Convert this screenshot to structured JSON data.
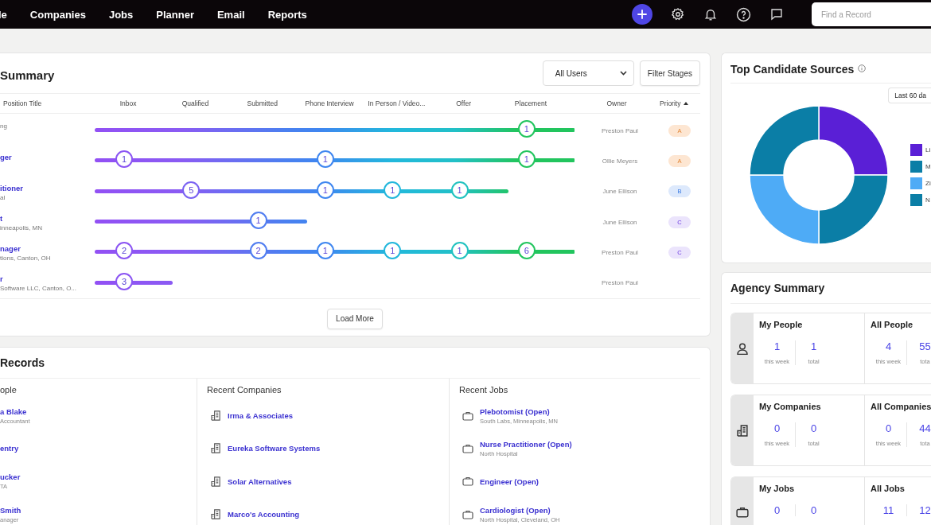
{
  "nav": {
    "items": [
      "le",
      "Companies",
      "Jobs",
      "Planner",
      "Email",
      "Reports"
    ]
  },
  "search": {
    "placeholder": "Find a Record"
  },
  "pipeline": {
    "title": "Summary",
    "user_filter": "All Users",
    "filter_button": "Filter Stages",
    "columns": {
      "title": "Position Title",
      "stages": [
        "Inbox",
        "Qualified",
        "Submitted",
        "Phone Interview",
        "In Person / Video...",
        "Offer",
        "Placement"
      ],
      "owner": "Owner",
      "priority": "Priority"
    },
    "rows": [
      {
        "subtitle": "ng",
        "stages": [
          {
            "reached": false
          },
          {
            "reached": false
          },
          {
            "reached": false
          },
          {
            "reached": false
          },
          {
            "reached": false
          },
          {
            "reached": false
          },
          {
            "reached": true,
            "count": "1"
          }
        ],
        "owner": "Preston Paul",
        "priority": {
          "label": "A",
          "color": "#fde6d2"
        }
      },
      {
        "title": "ger",
        "stages": [
          {
            "reached": true,
            "count": "1"
          },
          {
            "reached": false
          },
          {
            "reached": false
          },
          {
            "reached": true,
            "count": "1"
          },
          {
            "reached": false
          },
          {
            "reached": false
          },
          {
            "reached": true,
            "count": "1"
          }
        ],
        "owner": "Ollie Meyers",
        "priority": {
          "label": "A",
          "color": "#fde6d2"
        }
      },
      {
        "title": "itioner",
        "subtitle": "al",
        "stages": [
          {
            "reached": false
          },
          {
            "reached": true,
            "count": "5"
          },
          {
            "reached": false
          },
          {
            "reached": true,
            "count": "1"
          },
          {
            "reached": true,
            "count": "1"
          },
          {
            "reached": true,
            "count": "1"
          },
          {
            "reached": false
          }
        ],
        "owner": "June Ellison",
        "priority": {
          "label": "B",
          "color": "#dde9fc"
        }
      },
      {
        "title": "t",
        "subtitle": "inneapolis, MN",
        "stages": [
          {
            "reached": false
          },
          {
            "reached": false
          },
          {
            "reached": true,
            "count": "1"
          },
          {
            "reached": false
          },
          {
            "reached": false
          },
          {
            "reached": false
          },
          {
            "reached": false
          }
        ],
        "owner": "June Ellison",
        "priority": {
          "label": "C",
          "color": "#ebe4fc"
        }
      },
      {
        "title": "nager",
        "subtitle": "tions, Canton, OH",
        "stages": [
          {
            "reached": true,
            "count": "2"
          },
          {
            "reached": false
          },
          {
            "reached": true,
            "count": "2"
          },
          {
            "reached": true,
            "count": "1"
          },
          {
            "reached": true,
            "count": "1"
          },
          {
            "reached": true,
            "count": "1"
          },
          {
            "reached": true,
            "count": "6"
          }
        ],
        "owner": "Preston Paul",
        "priority": {
          "label": "C",
          "color": "#ebe4fc"
        }
      },
      {
        "title": "r",
        "subtitle": "Software LLC, Canton, O...",
        "stages": [
          {
            "reached": true,
            "count": "3"
          },
          {
            "reached": false
          },
          {
            "reached": false
          },
          {
            "reached": false
          },
          {
            "reached": false
          },
          {
            "reached": false
          },
          {
            "reached": false
          }
        ],
        "owner": "Preston Paul"
      }
    ],
    "load_more": "Load More"
  },
  "records": {
    "title": "Records",
    "people": {
      "heading": "ople",
      "items": [
        {
          "name": "a Blake",
          "sub": "Accountant"
        },
        {
          "name": "entry"
        },
        {
          "name": "ucker",
          "sub": "TA"
        },
        {
          "name": "Smith",
          "sub": "anager"
        }
      ]
    },
    "companies": {
      "heading": "Recent Companies",
      "items": [
        {
          "name": "Irma & Associates"
        },
        {
          "name": "Eureka Software Systems"
        },
        {
          "name": "Solar Alternatives"
        },
        {
          "name": "Marco's Accounting"
        }
      ]
    },
    "jobs": {
      "heading": "Recent Jobs",
      "items": [
        {
          "name": "Plebotomist (Open)",
          "sub": "South Labs, Minneapolis, MN"
        },
        {
          "name": "Nurse Practitioner (Open)",
          "sub": "North Hospital"
        },
        {
          "name": "Engineer (Open)"
        },
        {
          "name": "Cardiologist (Open)",
          "sub": "North Hospital, Cleveland, OH"
        }
      ]
    }
  },
  "sources": {
    "title": "Top Candidate Sources",
    "range": "Last 60 da",
    "legend": [
      {
        "label": "Li",
        "color": "#5a1fd6"
      },
      {
        "label": "M",
        "color": "#0b7ea6"
      },
      {
        "label": "Zi",
        "color": "#4eabf6"
      },
      {
        "label": "N",
        "color": "#0b7ea6"
      }
    ]
  },
  "agency": {
    "title": "Agency Summary",
    "groups": [
      {
        "kind": "people",
        "sections": [
          {
            "title": "My People",
            "stats": [
              {
                "value": "1",
                "label": "this week"
              },
              {
                "value": "1",
                "label": "total"
              }
            ]
          },
          {
            "title": "All People",
            "stats": [
              {
                "value": "4",
                "label": "this week"
              },
              {
                "value": "55",
                "label": "tota"
              }
            ]
          }
        ]
      },
      {
        "kind": "companies",
        "sections": [
          {
            "title": "My Companies",
            "stats": [
              {
                "value": "0",
                "label": "this week"
              },
              {
                "value": "0",
                "label": "total"
              }
            ]
          },
          {
            "title": "All Companies",
            "stats": [
              {
                "value": "0",
                "label": "this week"
              },
              {
                "value": "44",
                "label": "tota"
              }
            ]
          }
        ]
      },
      {
        "kind": "jobs",
        "sections": [
          {
            "title": "My Jobs",
            "stats": [
              {
                "value": "0"
              },
              {
                "value": "0"
              }
            ]
          },
          {
            "title": "All Jobs",
            "stats": [
              {
                "value": "11"
              },
              {
                "value": "12"
              }
            ]
          }
        ]
      }
    ]
  }
}
